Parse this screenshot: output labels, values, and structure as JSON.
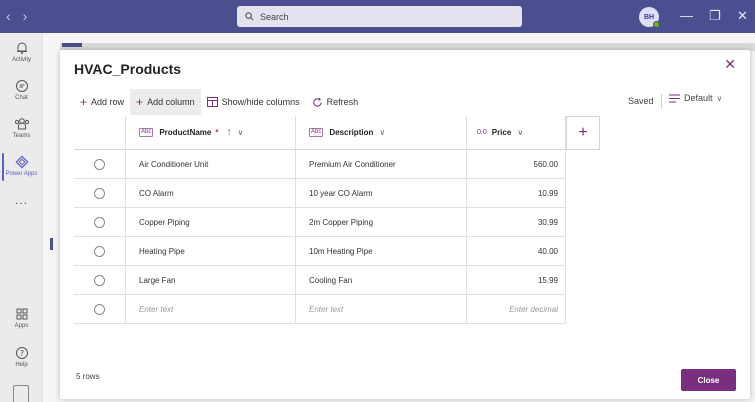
{
  "titlebar": {
    "search_placeholder": "Search",
    "avatar_initials": "BH",
    "back_glyph": "‹",
    "forward_glyph": "›",
    "minimize_glyph": "—",
    "restore_glyph": "❐",
    "close_glyph": "✕"
  },
  "rail": {
    "items": [
      {
        "label": "Activity",
        "icon": "bell-icon"
      },
      {
        "label": "Chat",
        "icon": "chat-icon"
      },
      {
        "label": "Teams",
        "icon": "teams-icon"
      },
      {
        "label": "Power Apps",
        "icon": "power-apps-icon",
        "active": true
      },
      {
        "label": "...",
        "icon": "more-icon"
      },
      {
        "label": "Apps",
        "icon": "apps-icon"
      },
      {
        "label": "Help",
        "icon": "help-icon"
      }
    ]
  },
  "dialog": {
    "title": "HVAC_Products",
    "close_glyph": "✕",
    "toolbar": {
      "add_row": "Add row",
      "add_column": "Add column",
      "show_hide": "Show/hide columns",
      "refresh": "Refresh",
      "saved": "Saved",
      "view": "Default"
    },
    "columns": [
      {
        "label": "ProductName",
        "type_icon": "Abc",
        "required": "*"
      },
      {
        "label": "Description",
        "type_icon": "Abc"
      },
      {
        "label": "Price",
        "type_icon": "0.0"
      }
    ],
    "rows": [
      {
        "name": "Air Conditioner Unit",
        "description": "Premium Air Conditioner",
        "price": "560.00"
      },
      {
        "name": "CO Alarm",
        "description": "10 year CO Alarm",
        "price": "10.99"
      },
      {
        "name": "Copper Piping",
        "description": "2m Copper Piping",
        "price": "30.99"
      },
      {
        "name": "Heating Pipe",
        "description": "10m Heating Pipe",
        "price": "40.00"
      },
      {
        "name": "Large Fan",
        "description": "Cooling Fan",
        "price": "15.99"
      }
    ],
    "new_row": {
      "name_placeholder": "Enter text",
      "description_placeholder": "Enter text",
      "price_placeholder": "Enter decimal"
    },
    "row_count": "5 rows",
    "close_label": "Close"
  },
  "colors": {
    "titlebar": "#4b4e8f",
    "accent": "#7a2e7e",
    "rail_active": "#5b5fc7"
  }
}
